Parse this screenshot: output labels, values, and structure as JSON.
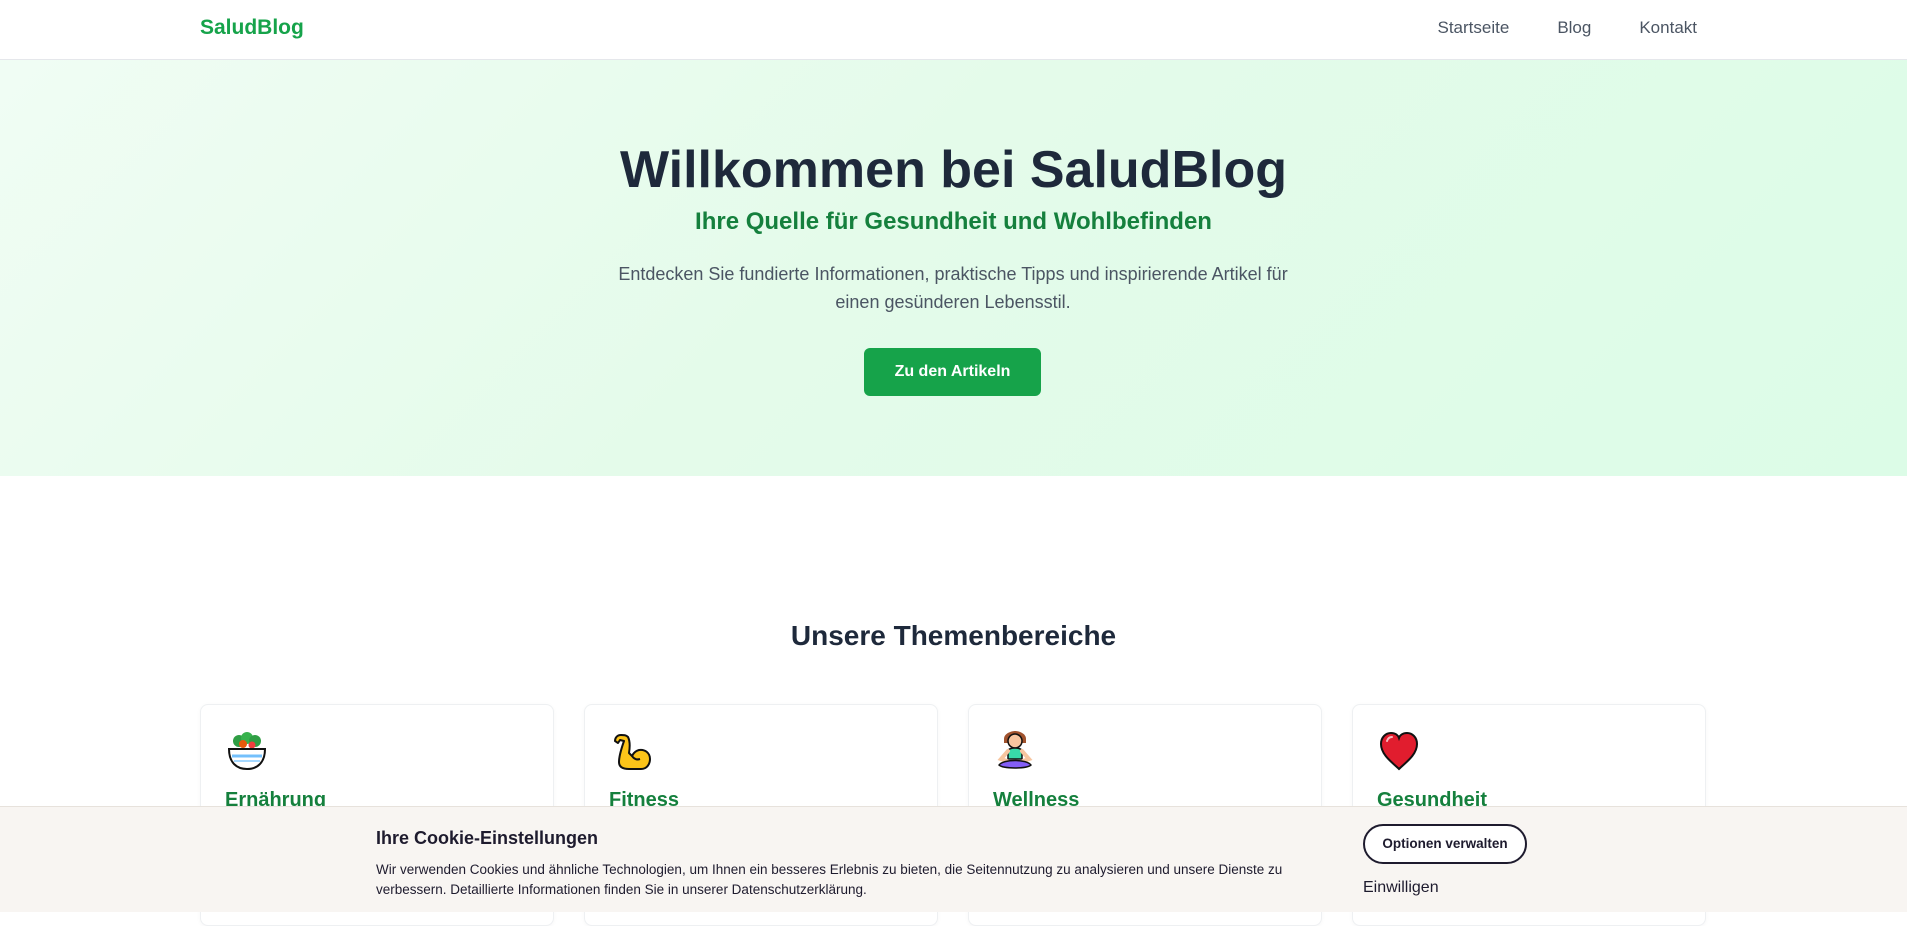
{
  "brand": "SaludBlog",
  "nav": [
    "Startseite",
    "Blog",
    "Kontakt"
  ],
  "hero": {
    "title": "Willkommen bei SaludBlog",
    "subtitle": "Ihre Quelle für Gesundheit und Wohlbefinden",
    "description": "Entdecken Sie fundierte Informationen, praktische Tipps und inspirierende Artikel für einen gesünderen Lebensstil.",
    "cta": "Zu den Artikeln"
  },
  "topics": {
    "title": "Unsere Themenbereiche",
    "items": [
      {
        "label": "Ernährung",
        "icon": "salad-icon"
      },
      {
        "label": "Fitness",
        "icon": "flexed-biceps-icon"
      },
      {
        "label": "Wellness",
        "icon": "meditation-icon"
      },
      {
        "label": "Gesundheit",
        "icon": "heart-icon"
      }
    ]
  },
  "cookie": {
    "title": "Ihre Cookie-Einstellungen",
    "text": "Wir verwenden Cookies und ähnliche Technologien, um Ihnen ein besseres Erlebnis zu bieten, die Seitennutzung zu analysieren und unsere Dienste zu verbessern. Detaillierte Informationen finden Sie in unserer Datenschutzerklärung.",
    "manage": "Optionen verwalten",
    "accept": "Einwilligen"
  },
  "colors": {
    "brand_green": "#16a34a",
    "heading_dark": "#1e293b",
    "heart_red": "#e11d2e"
  }
}
